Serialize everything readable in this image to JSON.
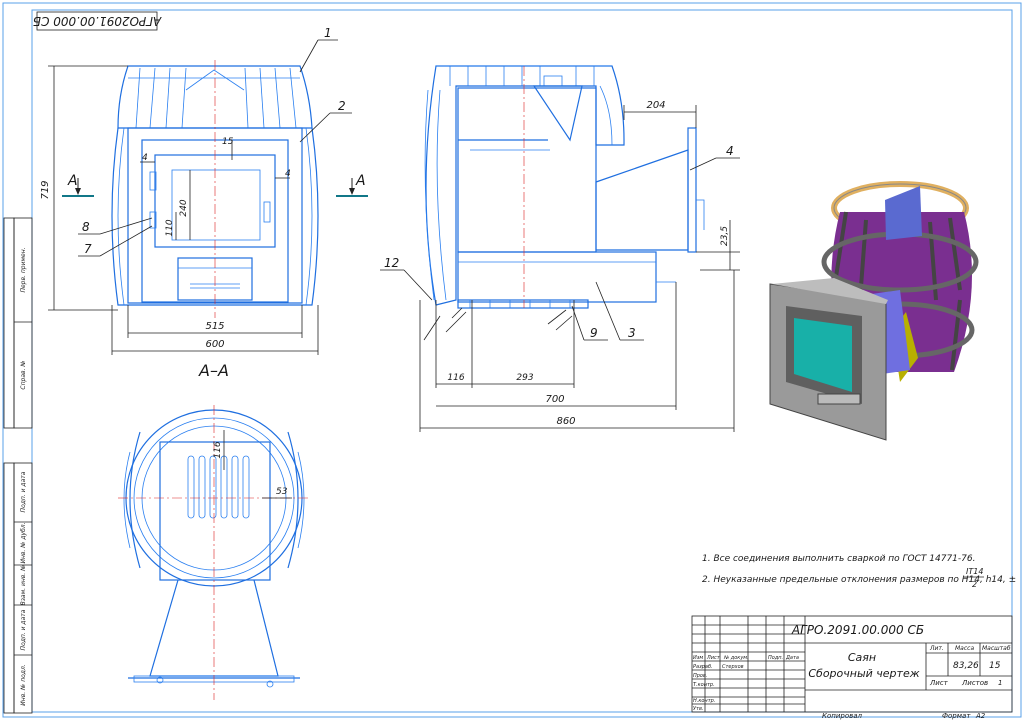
{
  "doc_code": "АГРО.2091.00.000 СБ",
  "doc_code_rotated": "АГРО2091.00.000 СБ",
  "product_name": "Саян",
  "doc_type": "Сборочный чертеж",
  "mass": "83,26",
  "scale": "15",
  "sheet_label": "Лист",
  "sheets_label": "Листов",
  "sheets_count": "1",
  "format_label": "Формат",
  "format_value": "А2",
  "copied_label": "Копировал",
  "section_label": "А–А",
  "section_letter": "А",
  "tb_headers": {
    "lit": "Лит.",
    "massa": "Масса",
    "masshtab": "Масштаб",
    "izm": "Изм",
    "list": "Лист",
    "ndokum": "№ докум.",
    "podp": "Подп.",
    "data": "Дата",
    "razrab": "Разраб.",
    "razrab_name": "Стерхов",
    "prov": "Пров.",
    "tkontr": "Т.контр.",
    "nkontr": "Н.контр.",
    "utv": "Утв."
  },
  "notes": [
    "1. Все соединения выполнить сваркой по ГОСТ 14771-76.",
    "2. Неуказанные предельные отклонения размеров по Н14, h14, ±"
  ],
  "note_fraction_top": "IT14",
  "note_fraction_bottom": "2",
  "side_strip": [
    "Перв. примен.",
    "Справ. №",
    "Подп. и дата",
    "Инв. № дубл.",
    "Взам. инв. №",
    "Подп. и дата",
    "Инв. № подл."
  ],
  "dims": {
    "d719": "719",
    "d515": "515",
    "d600": "600",
    "d15": "15",
    "d4a": "4",
    "d4b": "4",
    "d240": "240",
    "d110": "110",
    "d204": "204",
    "d235": "23,5",
    "d116": "116",
    "d293": "293",
    "d700": "700",
    "d860": "860",
    "d116b": "116",
    "d53": "53"
  },
  "callouts": [
    "1",
    "2",
    "3",
    "4",
    "7",
    "8",
    "9",
    "12"
  ]
}
